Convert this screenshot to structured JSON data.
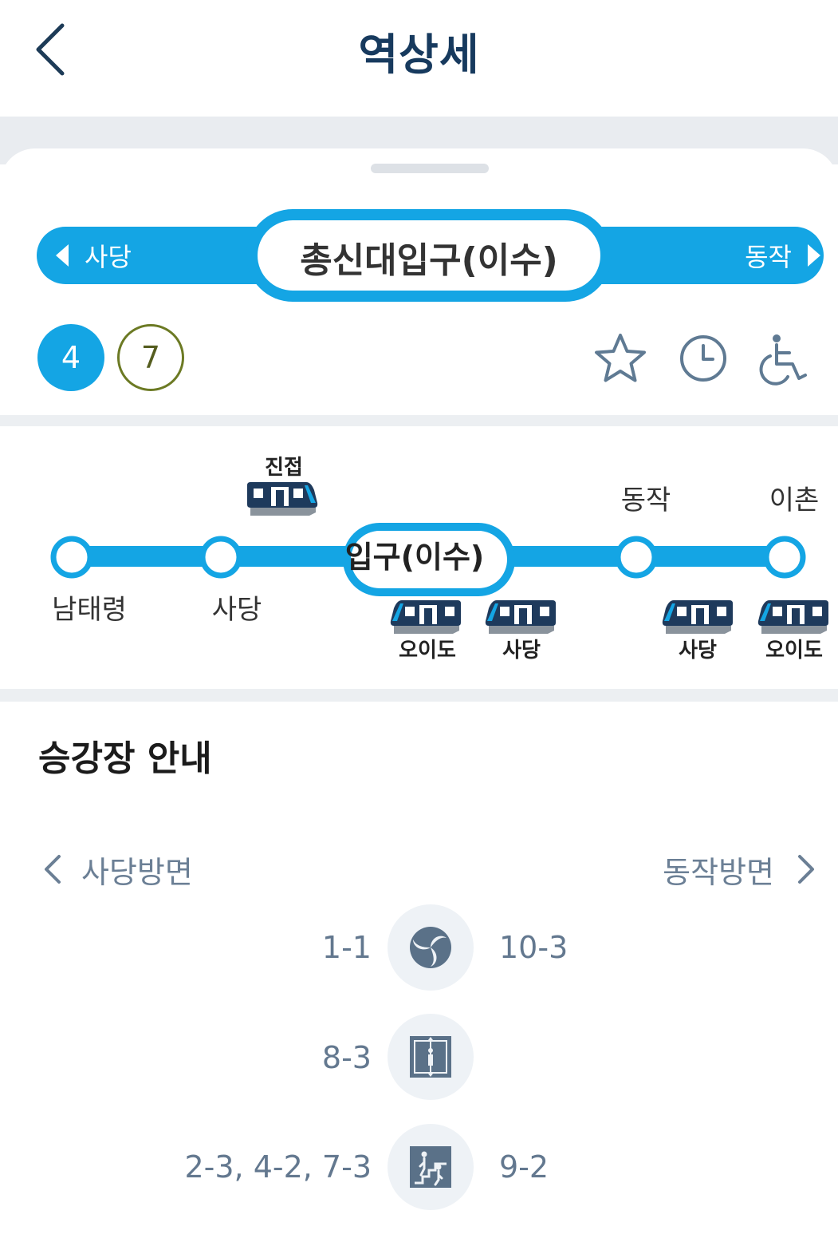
{
  "header": {
    "title": "역상세"
  },
  "banner": {
    "station_name": "총신대입구(이수)",
    "prev_station": "사당",
    "next_station": "동작",
    "line_color": "#14a5e4"
  },
  "lines": [
    {
      "label": "4",
      "color": "#14a5e4"
    },
    {
      "label": "7",
      "color": "#6c7a24"
    }
  ],
  "route_map": {
    "stations": [
      {
        "name": "남태령",
        "label_pos": "below"
      },
      {
        "name": "사당",
        "label_pos": "below"
      },
      {
        "name": "입구(이수)",
        "label_pos": "center"
      },
      {
        "name": "동작",
        "label_pos": "above"
      },
      {
        "name": "이촌",
        "label_pos": "above"
      }
    ],
    "approach_label": "진접",
    "trains": [
      {
        "destination": "오이도"
      },
      {
        "destination": "사당"
      },
      {
        "destination": "사당"
      },
      {
        "destination": "오이도"
      }
    ]
  },
  "platform_guide": {
    "title": "승강장 안내",
    "left_direction": "사당방면",
    "right_direction": "동작방면",
    "facilities": [
      {
        "icon": "transfer-icon",
        "left": "1-1",
        "right": "10-3"
      },
      {
        "icon": "elevator-icon",
        "left": "8-3",
        "right": ""
      },
      {
        "icon": "escalator-icon",
        "left": "2-3, 4-2, 7-3",
        "right": "9-2"
      }
    ]
  }
}
